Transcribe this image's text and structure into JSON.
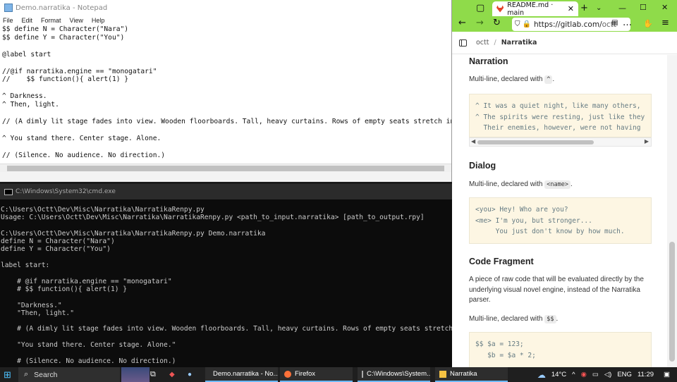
{
  "notepad": {
    "title": "Demo.narratika - Notepad",
    "menu": [
      "File",
      "Edit",
      "Format",
      "View",
      "Help"
    ],
    "text": "$$ define N = Character(\"Nara\")\n$$ define Y = Character(\"You\")\n\n@label start\n\n//@if narratika.engine == \"monogatari\"\n//    $$ function(){ alert(1) }\n\n^ Darkness.\n^ Then, light.\n\n// (A dimly lit stage fades into view. Wooden floorboards. Tall, heavy curtains. Rows of empty seats stretch into\n\n^ You stand there. Center stage. Alone.\n\n// (Silence. No audience. No direction.)"
  },
  "console": {
    "title": "C:\\Windows\\System32\\cmd.exe",
    "text": "C:\\Users\\Octt\\Dev\\Misc\\Narratika\\NarratikaRenpy.py\nUsage: C:\\Users\\Octt\\Dev\\Misc\\Narratika\\NarratikaRenpy.py <path_to_input.narratika> [path_to_output.rpy]\n\nC:\\Users\\Octt\\Dev\\Misc\\Narratika\\NarratikaRenpy.py Demo.narratika\ndefine N = Character(\"Nara\")\ndefine Y = Character(\"You\")\n\nlabel start:\n\n    # @if narratika.engine == \"monogatari\"\n    # $$ function(){ alert(1) }\n\n    \"Darkness.\"\n    \"Then, light.\"\n\n    # (A dimly lit stage fades into view. Wooden floorboards. Tall, heavy curtains. Rows of empty seats stretch in\n\n    \"You stand there. Center stage. Alone.\"\n\n    # (Silence. No audience. No direction.)"
  },
  "browser": {
    "tab_title": "README.md · main",
    "url_main": "https://gitlab.com/",
    "url_dim": "octt",
    "breadcrumb": [
      "octt",
      "Narratika"
    ],
    "sections": {
      "narration_heading": "Narration",
      "narration_desc_pre": "Multi-line, declared with",
      "narration_code_token": "^",
      "narration_code": "^ It was a quiet night, like many others,\n^ The spirits were resting, just like they\n  Their enemies, however, were not having",
      "dialog_heading": "Dialog",
      "dialog_desc_pre": "Multi-line, declared with",
      "dialog_code_token": "<name>",
      "dialog_code": "<you> Hey! Who are you?\n<me> I'm you, but stronger...\n     You just don't know by how much.",
      "fragment_heading": "Code Fragment",
      "fragment_desc": "A piece of raw code that will be evaluated directly by the underlying visual novel engine, instead of the Narratika parser.",
      "fragment_desc2_pre": "Multi-line, declared with",
      "fragment_code_token": "$$",
      "fragment_code": "$$ $a = 123;\n   $b = $a * 2;"
    }
  },
  "taskbar": {
    "search": "Search",
    "apps": [
      {
        "label": "Demo.narratika - No...",
        "color": "#5aa0e0"
      },
      {
        "label": "Firefox",
        "color": "#ff7139"
      },
      {
        "label": "C:\\Windows\\System...",
        "color": "#888888"
      },
      {
        "label": "Narratika",
        "color": "#f5c242"
      }
    ],
    "weather": "14°C",
    "lang": "ENG",
    "time": "11:29"
  }
}
